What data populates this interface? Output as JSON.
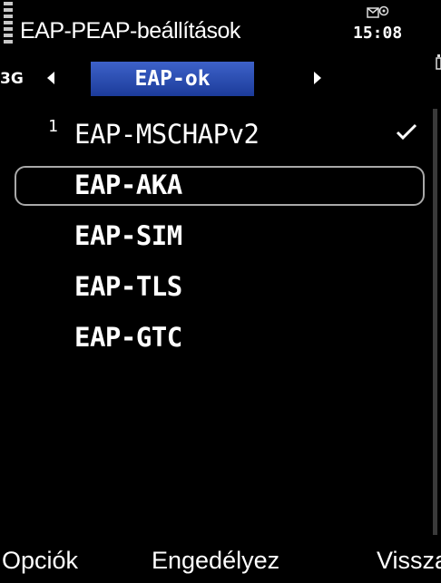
{
  "header": {
    "title": "EAP-PEAP-beállítások",
    "time": "15:08",
    "message_icon": "message-envelope-icon"
  },
  "tabs": {
    "network_indicator": "3G",
    "active_tab": "EAP-ok",
    "left_arrow": "arrow-left-icon",
    "right_arrow": "arrow-right-icon"
  },
  "list": {
    "items": [
      {
        "priority": "1",
        "label": "EAP-MSCHAPv2",
        "enabled": true
      },
      {
        "priority": "",
        "label": "EAP-AKA",
        "enabled": false,
        "selected": true
      },
      {
        "priority": "",
        "label": "EAP-SIM",
        "enabled": false
      },
      {
        "priority": "",
        "label": "EAP-TLS",
        "enabled": false
      },
      {
        "priority": "",
        "label": "EAP-GTC",
        "enabled": false
      }
    ]
  },
  "softkeys": {
    "left": "Opciók",
    "center": "Engedélyez",
    "right": "Vissza"
  },
  "colors": {
    "background": "#000000",
    "tab_active": "#2a4db5",
    "text": "#ffffff",
    "highlight_border": "#a9a9a9"
  }
}
